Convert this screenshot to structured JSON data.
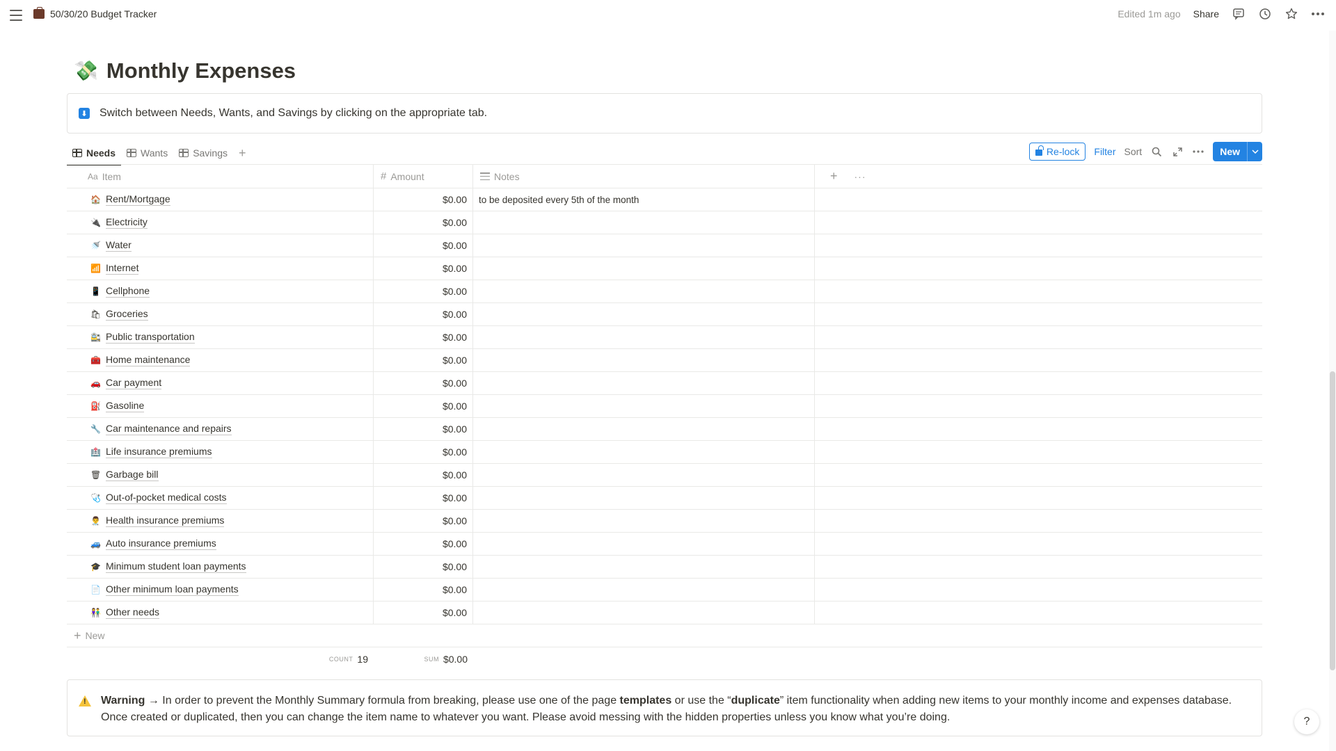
{
  "header": {
    "breadcrumb": "50/30/20 Budget Tracker",
    "edited": "Edited 1m ago",
    "share_label": "Share",
    "icons": [
      "hamburger-icon",
      "briefcase-icon",
      "comment-icon",
      "clock-icon",
      "star-icon",
      "more-icon"
    ]
  },
  "page": {
    "emoji": "💸",
    "title": "Monthly Expenses"
  },
  "callout": {
    "icon": "⬇",
    "text": "Switch between Needs, Wants, and Savings by clicking on the appropriate tab."
  },
  "tabs": [
    {
      "label": "Needs",
      "active": true
    },
    {
      "label": "Wants",
      "active": false
    },
    {
      "label": "Savings",
      "active": false
    }
  ],
  "toolbar": {
    "relock_label": "Re-lock",
    "filter_label": "Filter",
    "sort_label": "Sort",
    "new_label": "New",
    "accent_color": "#2383e2"
  },
  "table": {
    "columns": {
      "item_prefix": "Aa",
      "item": "Item",
      "amount_prefix": "#",
      "amount": "Amount",
      "notes": "Notes"
    },
    "rows": [
      {
        "icon": "🏠",
        "name": "Rent/Mortgage",
        "amount": "$0.00",
        "notes": "to be deposited every 5th of the month"
      },
      {
        "icon": "🔌",
        "name": "Electricity",
        "amount": "$0.00",
        "notes": ""
      },
      {
        "icon": "🚿",
        "name": "Water",
        "amount": "$0.00",
        "notes": ""
      },
      {
        "icon": "📶",
        "name": "Internet",
        "amount": "$0.00",
        "notes": ""
      },
      {
        "icon": "📱",
        "name": "Cellphone",
        "amount": "$0.00",
        "notes": ""
      },
      {
        "icon": "🛍",
        "name": "Groceries",
        "amount": "$0.00",
        "notes": ""
      },
      {
        "icon": "🚉",
        "name": "Public transportation",
        "amount": "$0.00",
        "notes": ""
      },
      {
        "icon": "🧰",
        "name": "Home maintenance",
        "amount": "$0.00",
        "notes": ""
      },
      {
        "icon": "🚗",
        "name": "Car payment",
        "amount": "$0.00",
        "notes": ""
      },
      {
        "icon": "⛽",
        "name": "Gasoline",
        "amount": "$0.00",
        "notes": ""
      },
      {
        "icon": "🔧",
        "name": "Car maintenance and repairs",
        "amount": "$0.00",
        "notes": ""
      },
      {
        "icon": "🏥",
        "name": "Life insurance premiums",
        "amount": "$0.00",
        "notes": ""
      },
      {
        "icon": "🗑",
        "name": "Garbage bill",
        "amount": "$0.00",
        "notes": ""
      },
      {
        "icon": "🩺",
        "name": "Out-of-pocket medical costs",
        "amount": "$0.00",
        "notes": ""
      },
      {
        "icon": "👨‍⚕️",
        "name": "Health insurance premiums",
        "amount": "$0.00",
        "notes": ""
      },
      {
        "icon": "🚙",
        "name": "Auto insurance premiums",
        "amount": "$0.00",
        "notes": ""
      },
      {
        "icon": "🎓",
        "name": "Minimum student loan payments",
        "amount": "$0.00",
        "notes": ""
      },
      {
        "icon": "📄",
        "name": "Other minimum loan payments",
        "amount": "$0.00",
        "notes": ""
      },
      {
        "icon": "👫",
        "name": "Other needs",
        "amount": "$0.00",
        "notes": ""
      }
    ],
    "new_row_label": "New",
    "footer": {
      "count_label": "COUNT",
      "count_value": "19",
      "sum_label": "SUM",
      "sum_value": "$0.00"
    }
  },
  "warning": {
    "lead": "Warning →",
    "text1": " In order to prevent the Monthly Summary formula from breaking, please use one of the page ",
    "bold1": "templates",
    "text2": " or use the “",
    "bold2": "duplicate",
    "text3": "” item functionality when adding new items to your monthly income and expenses database. Once created or duplicated, then you can change the item name to whatever you want. Please avoid messing with the hidden properties unless you know what you’re doing."
  },
  "help_label": "?"
}
